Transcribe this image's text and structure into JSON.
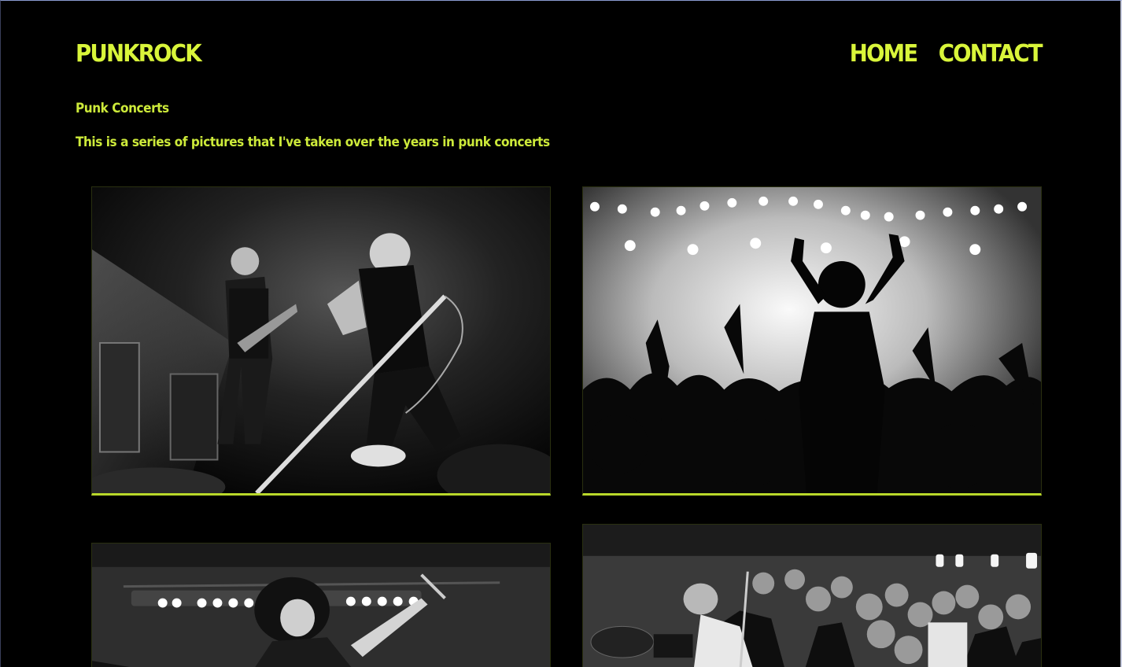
{
  "header": {
    "logo": "PUNKROCK",
    "nav": [
      {
        "label": "HOME"
      },
      {
        "label": "CONTACT"
      }
    ]
  },
  "main": {
    "title": "Punk Concerts",
    "description": "This is a series of pictures that I've taken over the years in punk concerts"
  },
  "gallery": [
    {
      "subject": "band-on-stage-singer-with-mic-stand"
    },
    {
      "subject": "crowd-raising-hands-stage-lights"
    },
    {
      "subject": "singer-with-curly-hair-stage-lights"
    },
    {
      "subject": "packed-crowd-small-club-show"
    }
  ],
  "colors": {
    "accent": "#d9f53a",
    "background": "#000000"
  }
}
